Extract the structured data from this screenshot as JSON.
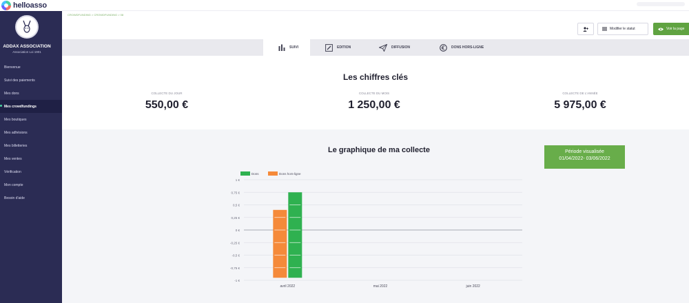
{
  "brand": {
    "name": "helloasso"
  },
  "org": {
    "name": "ADDAX ASSOCIATION",
    "subtitle": "Association Loi 1901"
  },
  "sidebar": {
    "items": [
      {
        "label": "Bienvenue"
      },
      {
        "label": "Suivi des paiements"
      },
      {
        "label": "Mes dons"
      },
      {
        "label": "Mes crowdfundings",
        "active": true
      },
      {
        "label": "Mes boutiques"
      },
      {
        "label": "Mes adhésions"
      },
      {
        "label": "Mes billetteries"
      },
      {
        "label": "Mes ventes"
      },
      {
        "label": "Vérification"
      },
      {
        "label": "Mon compte"
      },
      {
        "label": "Besoin d'aide"
      }
    ]
  },
  "breadcrumb": "CROWDFUNDING > CROWDFUNDING > 08",
  "toolbar": {
    "modify_label": "Modifier le statut",
    "view_label": "Voir la page"
  },
  "tabs": [
    {
      "label": "SUIVI",
      "icon": "bar-chart-icon",
      "active": true
    },
    {
      "label": "EDITION",
      "icon": "edit-icon"
    },
    {
      "label": "DIFFUSION",
      "icon": "paper-plane-icon"
    },
    {
      "label": "DONS HORS-LIGNE",
      "icon": "euro-circle-icon"
    }
  ],
  "key_figures": {
    "title": "Les chiffres clés",
    "day": {
      "label": "COLLECTE DU JOUR",
      "value": "550,00 €"
    },
    "month": {
      "label": "COLLECTE DU MOIS",
      "value": "1 250,00 €"
    },
    "year": {
      "label": "COLLECTE DE L'ANNÉE",
      "value": "5 975,00 €"
    }
  },
  "collecte": {
    "title": "Le graphique de ma collecte",
    "period_label": "Période visualisée",
    "period_range": "01/04/2022- 03/06/2022"
  },
  "colors": {
    "dons": "#2fb150",
    "dons_hors_ligne": "#f58a3a",
    "accent": "#68ad4a",
    "sidebar": "#2b2c54"
  },
  "chart_data": {
    "type": "bar",
    "categories": [
      "avril 2022",
      "mai 2022",
      "juin 2022"
    ],
    "series": [
      {
        "name": "Dons",
        "values": [
          0.75,
          null,
          null
        ]
      },
      {
        "name": "Dons hors-ligne",
        "values": [
          0.4,
          null,
          null
        ]
      }
    ],
    "bar_bottom": -0.95,
    "ylim": [
      -1,
      1
    ],
    "yticks": [
      1,
      0.75,
      0.5,
      0.25,
      0,
      -0.25,
      -0.5,
      -0.75,
      -1
    ],
    "ytick_labels": [
      "1 €",
      "0,75 €",
      "0,5 €",
      "0,25 €",
      "0 €",
      "-0,25 €",
      "-0,5 €",
      "-0,75 €",
      "-1 €"
    ],
    "legend_position": "top-left",
    "grid": true
  }
}
